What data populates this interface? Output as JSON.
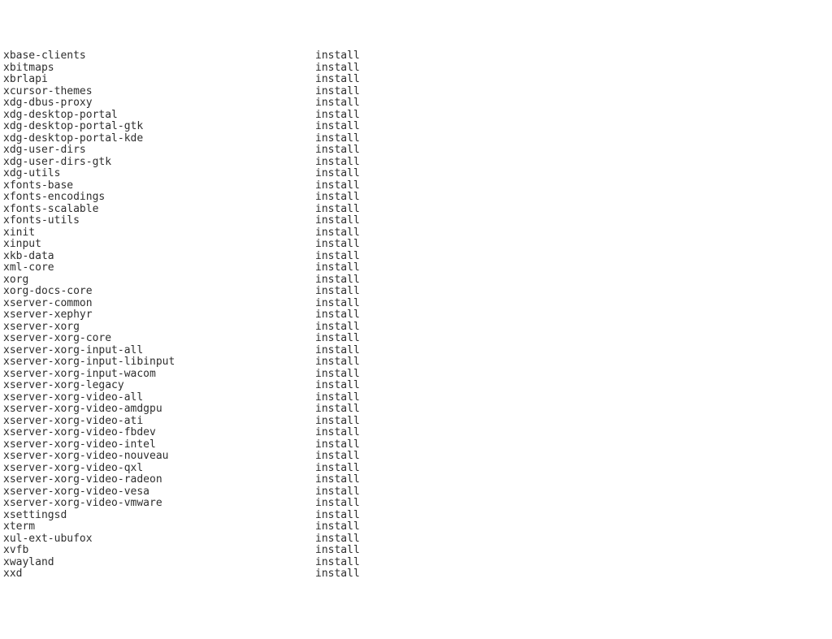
{
  "packages": [
    {
      "name": "xbase-clients",
      "status": "install"
    },
    {
      "name": "xbitmaps",
      "status": "install"
    },
    {
      "name": "xbrlapi",
      "status": "install"
    },
    {
      "name": "xcursor-themes",
      "status": "install"
    },
    {
      "name": "xdg-dbus-proxy",
      "status": "install"
    },
    {
      "name": "xdg-desktop-portal",
      "status": "install"
    },
    {
      "name": "xdg-desktop-portal-gtk",
      "status": "install"
    },
    {
      "name": "xdg-desktop-portal-kde",
      "status": "install"
    },
    {
      "name": "xdg-user-dirs",
      "status": "install"
    },
    {
      "name": "xdg-user-dirs-gtk",
      "status": "install"
    },
    {
      "name": "xdg-utils",
      "status": "install"
    },
    {
      "name": "xfonts-base",
      "status": "install"
    },
    {
      "name": "xfonts-encodings",
      "status": "install"
    },
    {
      "name": "xfonts-scalable",
      "status": "install"
    },
    {
      "name": "xfonts-utils",
      "status": "install"
    },
    {
      "name": "xinit",
      "status": "install"
    },
    {
      "name": "xinput",
      "status": "install"
    },
    {
      "name": "xkb-data",
      "status": "install"
    },
    {
      "name": "xml-core",
      "status": "install"
    },
    {
      "name": "xorg",
      "status": "install"
    },
    {
      "name": "xorg-docs-core",
      "status": "install"
    },
    {
      "name": "xserver-common",
      "status": "install"
    },
    {
      "name": "xserver-xephyr",
      "status": "install"
    },
    {
      "name": "xserver-xorg",
      "status": "install"
    },
    {
      "name": "xserver-xorg-core",
      "status": "install"
    },
    {
      "name": "xserver-xorg-input-all",
      "status": "install"
    },
    {
      "name": "xserver-xorg-input-libinput",
      "status": "install"
    },
    {
      "name": "xserver-xorg-input-wacom",
      "status": "install"
    },
    {
      "name": "xserver-xorg-legacy",
      "status": "install"
    },
    {
      "name": "xserver-xorg-video-all",
      "status": "install"
    },
    {
      "name": "xserver-xorg-video-amdgpu",
      "status": "install"
    },
    {
      "name": "xserver-xorg-video-ati",
      "status": "install"
    },
    {
      "name": "xserver-xorg-video-fbdev",
      "status": "install"
    },
    {
      "name": "xserver-xorg-video-intel",
      "status": "install"
    },
    {
      "name": "xserver-xorg-video-nouveau",
      "status": "install"
    },
    {
      "name": "xserver-xorg-video-qxl",
      "status": "install"
    },
    {
      "name": "xserver-xorg-video-radeon",
      "status": "install"
    },
    {
      "name": "xserver-xorg-video-vesa",
      "status": "install"
    },
    {
      "name": "xserver-xorg-video-vmware",
      "status": "install"
    },
    {
      "name": "xsettingsd",
      "status": "install"
    },
    {
      "name": "xterm",
      "status": "install"
    },
    {
      "name": "xul-ext-ubufox",
      "status": "install"
    },
    {
      "name": "xvfb",
      "status": "install"
    },
    {
      "name": "xwayland",
      "status": "install"
    },
    {
      "name": "xxd",
      "status": "install"
    }
  ]
}
